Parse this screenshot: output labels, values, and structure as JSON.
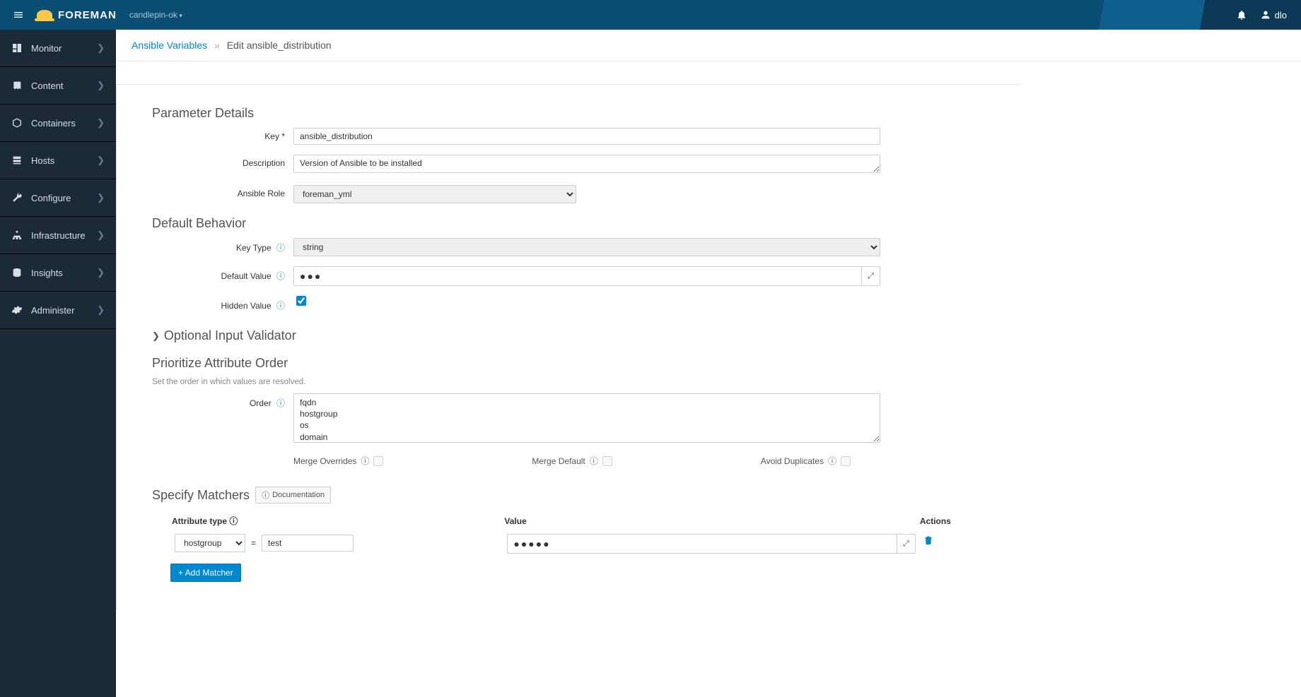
{
  "brand": "FOREMAN",
  "context": "candlepin-ok",
  "user": "dlo",
  "sidebar": {
    "items": [
      {
        "label": "Monitor"
      },
      {
        "label": "Content"
      },
      {
        "label": "Containers"
      },
      {
        "label": "Hosts"
      },
      {
        "label": "Configure"
      },
      {
        "label": "Infrastructure"
      },
      {
        "label": "Insights"
      },
      {
        "label": "Administer"
      }
    ]
  },
  "breadcrumb": {
    "parent": "Ansible Variables",
    "current": "Edit ansible_distribution"
  },
  "sections": {
    "param_details": "Parameter Details",
    "default_behavior": "Default Behavior",
    "optional_validator": "Optional Input Validator",
    "prioritize": "Prioritize Attribute Order",
    "prioritize_desc": "Set the order in which values are resolved.",
    "specify_matchers": "Specify Matchers",
    "documentation": "Documentation"
  },
  "labels": {
    "key": "Key",
    "description": "Description",
    "ansible_role": "Ansible Role",
    "key_type": "Key Type",
    "default_value": "Default Value",
    "hidden_value": "Hidden Value",
    "order": "Order",
    "merge_overrides": "Merge Overrides",
    "merge_default": "Merge Default",
    "avoid_duplicates": "Avoid Duplicates",
    "attribute_type": "Attribute type",
    "value": "Value",
    "actions": "Actions",
    "add_matcher": "+ Add Matcher"
  },
  "form": {
    "key": "ansible_distribution",
    "description": "Version of Ansible to be installed",
    "ansible_role": "foreman_yml",
    "key_type": "string",
    "default_value": "●●●",
    "hidden_value": true,
    "order": "fqdn\nhostgroup\nos\ndomain",
    "merge_overrides": false,
    "merge_default": false,
    "avoid_duplicates": false
  },
  "matchers": [
    {
      "attr": "hostgroup",
      "match": "test",
      "value": "●●●●●"
    }
  ]
}
